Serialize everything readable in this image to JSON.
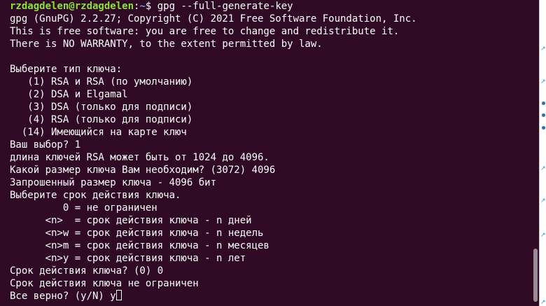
{
  "prompt": {
    "user_host": "rzdagdelen@rzdagdelen",
    "separator": ":",
    "path": "~",
    "symbol": "$ ",
    "command": "gpg --full-generate-key"
  },
  "output_lines": [
    "gpg (GnuPG) 2.2.27; Copyright (C) 2021 Free Software Foundation, Inc.",
    "This is free software: you are free to change and redistribute it.",
    "There is NO WARRANTY, to the extent permitted by law.",
    "",
    "Выберите тип ключа:",
    "   (1) RSA и RSA (по умолчанию)",
    "   (2) DSA и Elgamal",
    "   (3) DSA (только для подписи)",
    "   (4) RSA (только для подписи)",
    "  (14) Имеющийся на карте ключ",
    "Ваш выбор? 1",
    "длина ключей RSA может быть от 1024 до 4096.",
    "Какой размер ключа Вам необходим? (3072) 4096",
    "Запрошенный размер ключа - 4096 бит",
    "Выберите срок действия ключа.",
    "         0 = не ограничен",
    "      <n>  = срок действия ключа - n дней",
    "      <n>w = срок действия ключа - n недель",
    "      <n>m = срок действия ключа - n месяцев",
    "      <n>y = срок действия ключа - n лет",
    "Срок действия ключа? (0) 0",
    "Срок действия ключа не ограничен"
  ],
  "current_input": {
    "question": "Все верно? (y/N) ",
    "typed": "y"
  },
  "colors": {
    "background": "#300a24",
    "text": "#ffffff",
    "user_host": "#8ae234",
    "path": "#729fcf"
  }
}
